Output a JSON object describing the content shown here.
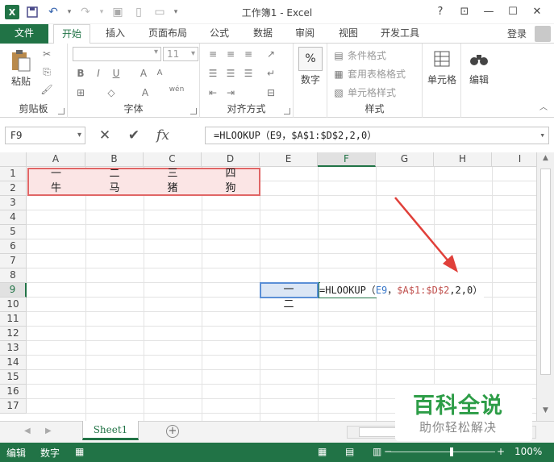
{
  "window": {
    "title": "工作簿1 - Excel",
    "controls": [
      "?",
      "⊡",
      "—",
      "☐",
      "✕"
    ]
  },
  "ribbon_tabs": [
    "文件",
    "开始",
    "插入",
    "页面布局",
    "公式",
    "数据",
    "审阅",
    "视图",
    "开发工具"
  ],
  "login_label": "登录",
  "ribbon": {
    "paste_label": "粘贴",
    "font_size": "11",
    "wen_label": "wén",
    "number_label": "数字",
    "cond_format": "条件格式",
    "table_format": "套用表格格式",
    "cell_style": "单元格样式",
    "cells_label": "单元格",
    "edit_label": "编辑",
    "groups": [
      "剪贴板",
      "字体",
      "对齐方式",
      "样式"
    ]
  },
  "formula_bar": {
    "name_box": "F9",
    "formula": "=HLOOKUP（E9，$A$1:$D$2,2,0）"
  },
  "columns": [
    "A",
    "B",
    "C",
    "D",
    "E",
    "F",
    "G",
    "H",
    "I"
  ],
  "rows": [
    "1",
    "2",
    "3",
    "4",
    "5",
    "6",
    "7",
    "8",
    "9",
    "10",
    "11",
    "12",
    "13",
    "14",
    "15",
    "16",
    "17"
  ],
  "cells": {
    "A1": "一",
    "B1": "二",
    "C1": "三",
    "D1": "四",
    "A2": "牛",
    "B2": "马",
    "C2": "猪",
    "D2": "狗",
    "E9": "一",
    "E10": "二"
  },
  "inline_formula": {
    "prefix": "=HLOOKUP（",
    "arg1": "E9",
    "sep1": "，",
    "arg2": "$A$1:$D$2",
    "rest": ",2,0）"
  },
  "sheet_tab": "Sheet1",
  "status": {
    "mode": "编辑",
    "num": "数字",
    "zoom": "100%"
  },
  "watermark": {
    "title": "百科全说",
    "subtitle": "助你轻松解决"
  },
  "colors": {
    "excel_green": "#217346",
    "pink_fill": "#fbe5e5",
    "red_border": "#e06666",
    "arrow_red": "#e0403a"
  }
}
